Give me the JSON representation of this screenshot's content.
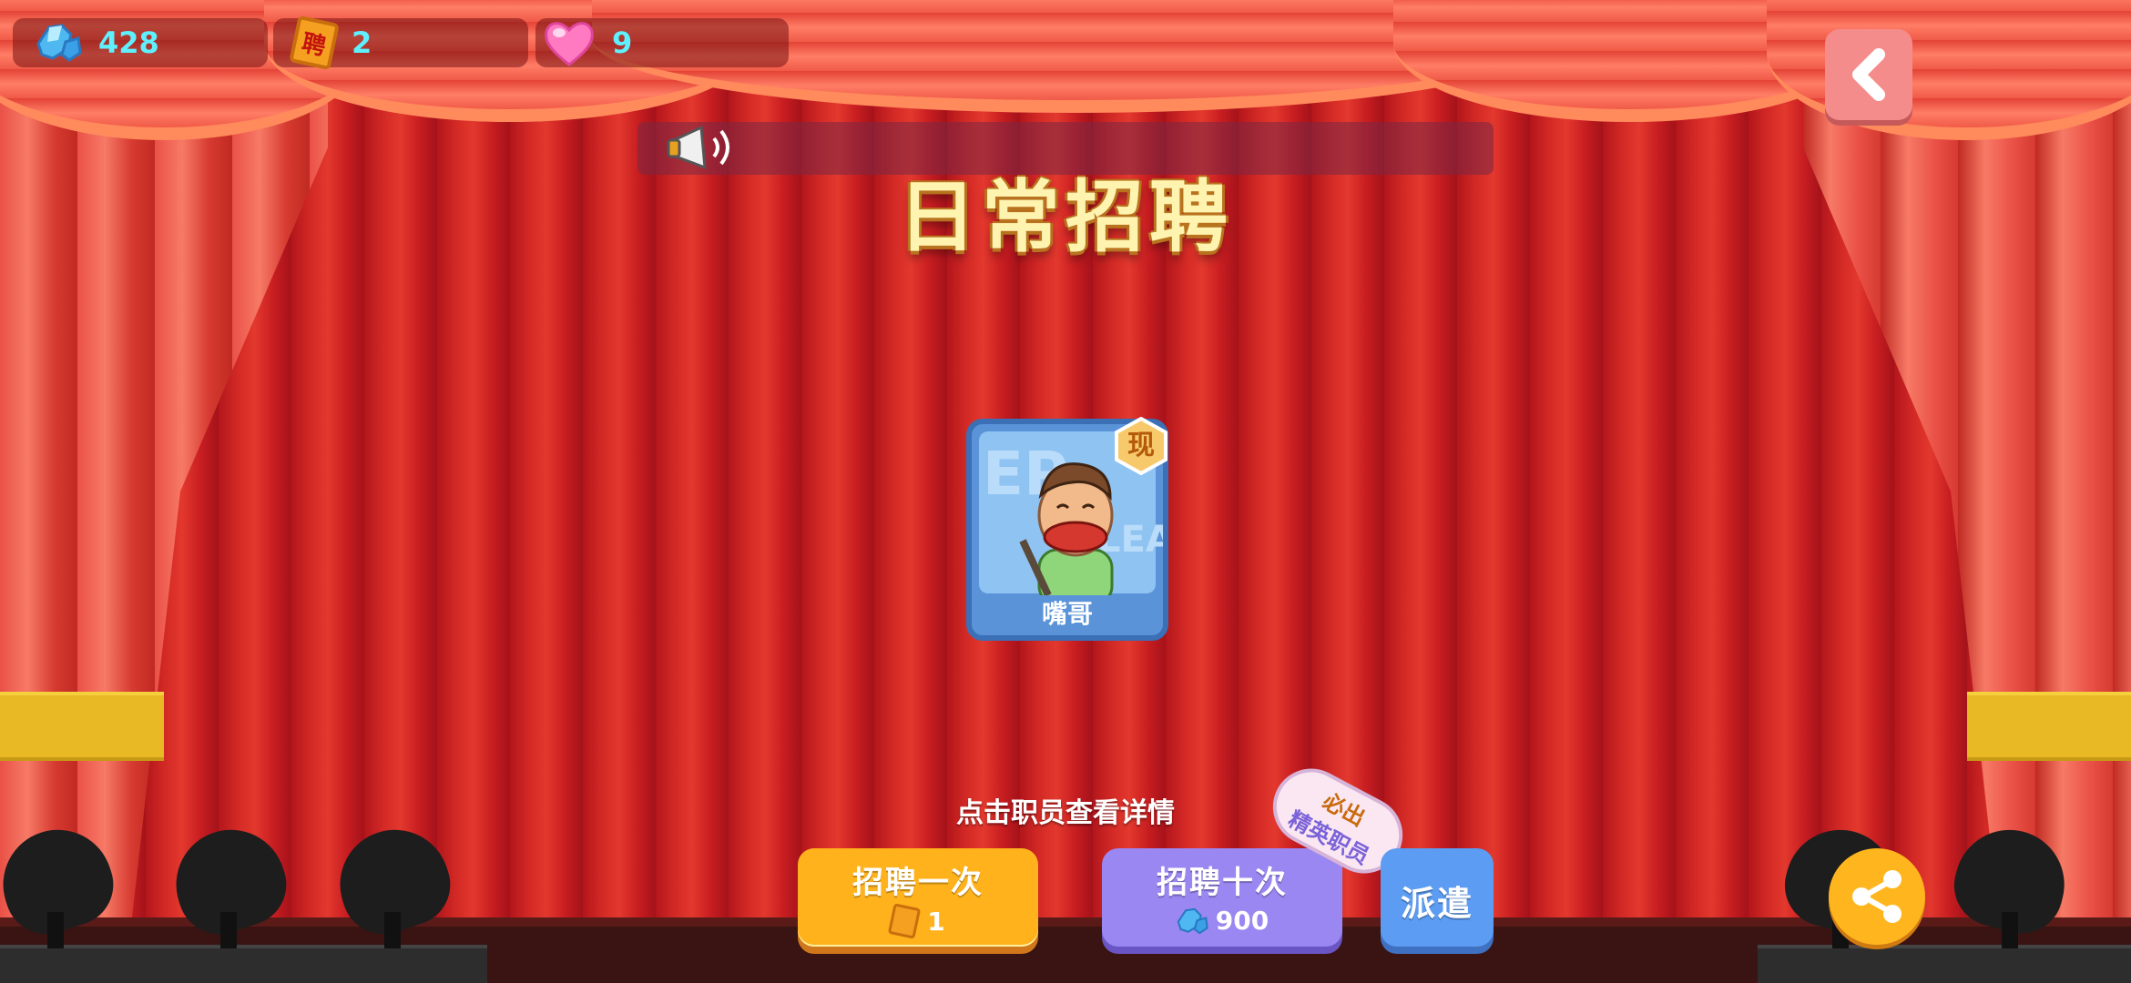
{
  "hud": {
    "gems": "428",
    "tickets": "2",
    "ticket_glyph": "聘",
    "hearts": "9"
  },
  "title": "日常招聘",
  "card": {
    "name": "嘴哥",
    "badge": "现",
    "bg_text_1": "EP",
    "bg_text_2": "LEA"
  },
  "hint": "点击职员查看详情",
  "buttons": {
    "once_label": "招聘一次",
    "once_cost": "1",
    "ten_label": "招聘十次",
    "ten_cost": "900",
    "dispatch_label": "派遣"
  },
  "bubble": {
    "line1": "必出",
    "line2": "精英职员"
  },
  "icons": [
    "gem-icon",
    "ticket-icon",
    "heart-icon",
    "back-arrow-icon",
    "megaphone-icon",
    "share-icon"
  ],
  "colors": {
    "gem_text": "#5ef0ff",
    "once_button": "#ffb21c",
    "ten_button": "#9a87f2",
    "dispatch_button": "#5c9cf2",
    "back_button": "#f58c8c",
    "share_button": "#ffb61e"
  }
}
